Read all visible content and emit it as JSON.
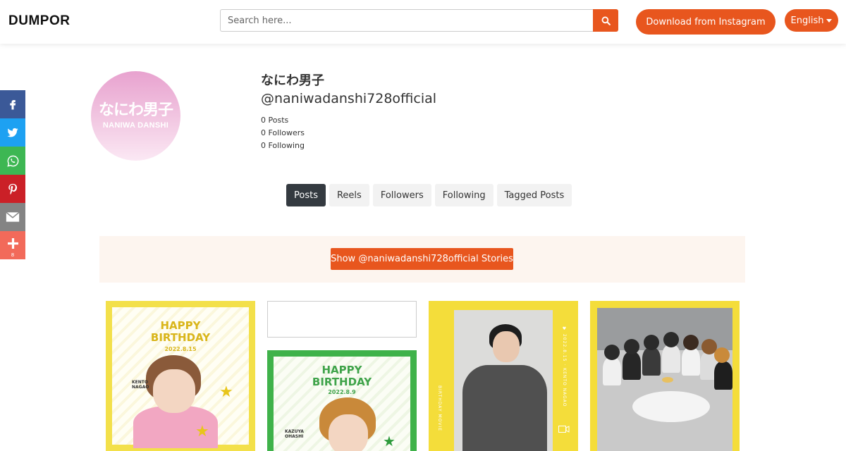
{
  "header": {
    "logo": "DUMPOR",
    "search_placeholder": "Search here...",
    "download_label": "Download from Instagram",
    "language_label": "English"
  },
  "share_bar": {
    "more_count": "8",
    "icons": [
      "facebook-icon",
      "twitter-icon",
      "whatsapp-icon",
      "pinterest-icon",
      "email-icon",
      "plus-icon"
    ]
  },
  "profile": {
    "avatar_jp": "なにわ男子",
    "avatar_en": "NANIWA DANSHI",
    "name": "なにわ男子",
    "handle": "@naniwadanshi728official",
    "posts": "0 Posts",
    "followers": "0 Followers",
    "following": "0 Following"
  },
  "tabs": [
    {
      "label": "Posts",
      "active": true
    },
    {
      "label": "Reels",
      "active": false
    },
    {
      "label": "Followers",
      "active": false
    },
    {
      "label": "Following",
      "active": false
    },
    {
      "label": "Tagged Posts",
      "active": false
    }
  ],
  "stories_button": "Show @naniwadanshi728official Stories",
  "posts": [
    {
      "heading": "HAPPY\nBIRTHDAY",
      "date": "2022.8.15",
      "name": "KENTO\nNAGAO"
    },
    {
      "heading": "HAPPY\nBIRTHDAY",
      "date": "2022.8.9",
      "name": "KAZUYA\nOHASHI"
    },
    {
      "left_text": "BIRTHDAY MOVIE",
      "right_text": "♥ 2022.8.15 · KENTO NAGAO"
    }
  ],
  "colors": {
    "accent": "#e8561e",
    "tab_active": "#343a40",
    "stories_bg": "#fdf5ef"
  }
}
